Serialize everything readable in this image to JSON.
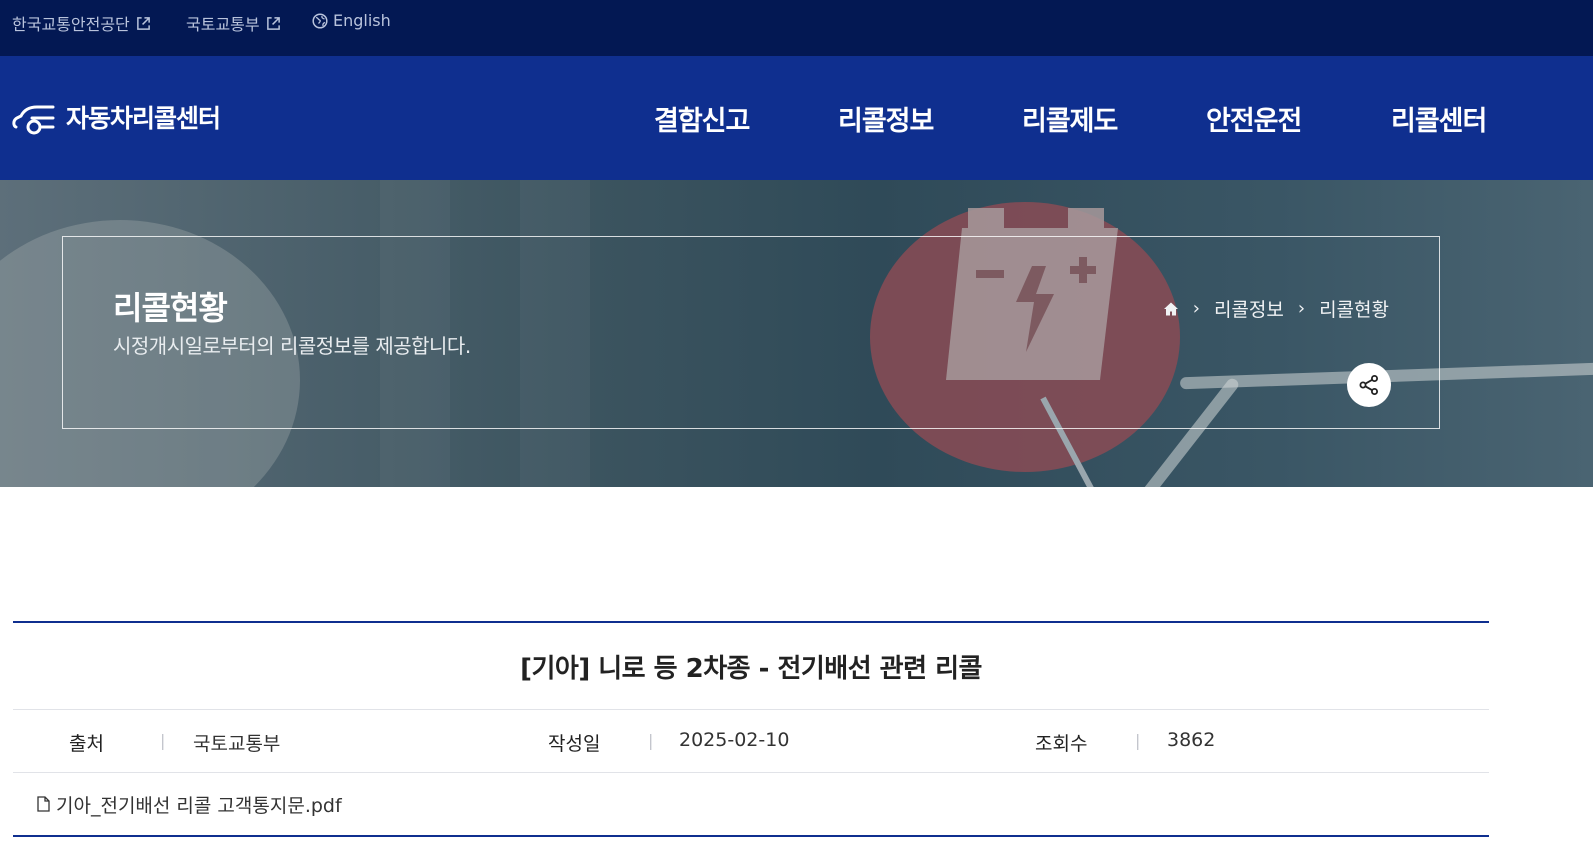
{
  "util": {
    "links": [
      {
        "label": "한국교통안전공단"
      },
      {
        "label": "국토교통부"
      },
      {
        "label": "English"
      }
    ]
  },
  "header": {
    "logo_text": "자동차리콜센터",
    "menu": [
      "결함신고",
      "리콜정보",
      "리콜제도",
      "안전운전",
      "리콜센터"
    ]
  },
  "visual": {
    "title": "리콜현황",
    "description": "시정개시일로부터의 리콜정보를 제공합니다.",
    "breadcrumb": [
      "리콜정보",
      "리콜현황"
    ]
  },
  "article": {
    "title": "[기아] 니로 등 2차종 - 전기배선 관련 리콜",
    "source_label": "출처",
    "source_value": "국토교통부",
    "date_label": "작성일",
    "date_value": "2025-02-10",
    "views_label": "조회수",
    "views_value": "3862",
    "attachment": "기아_전기배선 리콜 고객통지문.pdf"
  },
  "colors": {
    "util_bg": "#031853",
    "gnb_bg": "#0f2f8f",
    "accent_line": "#0f2f8f"
  },
  "icons": {
    "external": "external-link-icon",
    "globe": "globe-icon",
    "home": "home-icon",
    "share": "share-icon",
    "file": "file-icon"
  }
}
